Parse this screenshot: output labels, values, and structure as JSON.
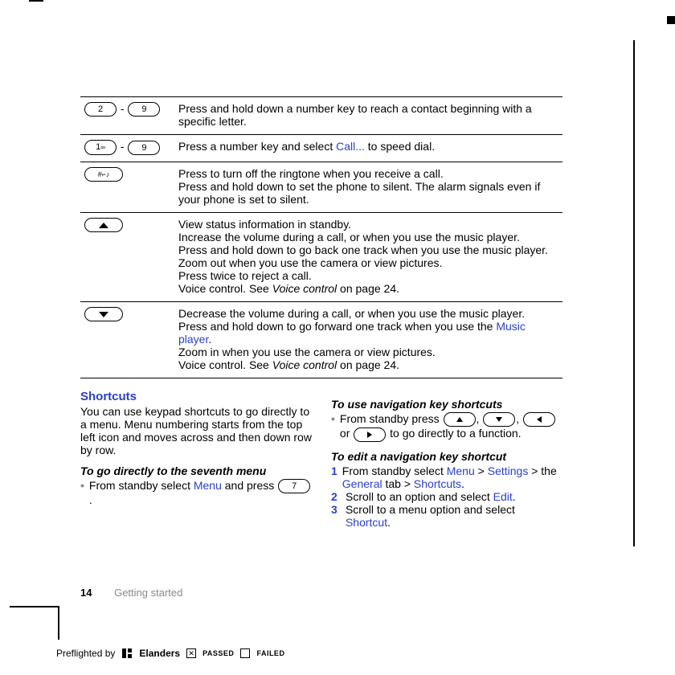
{
  "rows": [
    {
      "keymode": "range",
      "k1": "2",
      "k2": "9",
      "blocks": [
        {
          "text": "Press and hold down a number key to reach a contact beginning with a specific letter."
        }
      ]
    },
    {
      "keymode": "range",
      "k1": "1",
      "k1sub": "∞",
      "k2": "9",
      "blocks": [
        {
          "text": "Press a number key and select "
        },
        {
          "text": "Call...",
          "link": true
        },
        {
          "text": " to speed dial."
        }
      ]
    },
    {
      "keymode": "hash",
      "blocks": [
        {
          "text": "Press to turn off the ringtone when you receive a call."
        },
        {
          "br": true
        },
        {
          "text": "Press and hold down to set the phone to silent. The alarm signals even if your phone is set to silent."
        }
      ]
    },
    {
      "keymode": "up",
      "blocks": [
        {
          "text": "View status information in standby."
        },
        {
          "br": true
        },
        {
          "text": "Increase the volume during a call, or when you use the music player."
        },
        {
          "br": true
        },
        {
          "text": "Press and hold down to go back one track when you use the music player."
        },
        {
          "br": true
        },
        {
          "text": "Zoom out when you use the camera or view pictures."
        },
        {
          "br": true
        },
        {
          "text": "Press twice to reject a call."
        },
        {
          "br": true
        },
        {
          "text": "Voice control. See "
        },
        {
          "text": "Voice control",
          "ital": true
        },
        {
          "text": " on page 24."
        }
      ]
    },
    {
      "keymode": "down",
      "blocks": [
        {
          "text": "Decrease the volume during a call, or when you use the music player."
        },
        {
          "br": true
        },
        {
          "text": "Press and hold down to go forward one track when you use the "
        },
        {
          "text": "Music player",
          "link": true
        },
        {
          "text": "."
        },
        {
          "br": true
        },
        {
          "text": "Zoom in when you use the camera or view pictures."
        },
        {
          "br": true
        },
        {
          "text": "Voice control. See "
        },
        {
          "text": "Voice control",
          "ital": true
        },
        {
          "text": " on page 24."
        }
      ]
    }
  ],
  "shortcuts": {
    "heading": "Shortcuts",
    "intro": "You can use keypad shortcuts to go directly to a menu. Menu numbering starts from the top left icon and moves across and then down row by row.",
    "sevHead": "To go directly to the seventh menu",
    "sevA": "From standby select ",
    "menu": "Menu",
    "sevB": " and press ",
    "sevKey": "7",
    "sevC": " ."
  },
  "nav": {
    "useHead": "To use navigation key shortcuts",
    "useA": "From standby press ",
    "useB": " to go directly to a function.",
    "editHead": "To edit a navigation key shortcut",
    "s1a": "From standby select ",
    "menu": "Menu",
    "gt": " > ",
    "settings": "Settings",
    "s1b": " > the ",
    "general": "General",
    "s1c": " tab > ",
    "shortcutsLink": "Shortcuts",
    "dot": ".",
    "s2a": "Scroll to an option and select ",
    "edit": "Edit",
    "s3a": "Scroll to a menu option and select ",
    "shortcut": "Shortcut",
    "or": " or ",
    "comma": ",  "
  },
  "footer": {
    "page": "14",
    "section": "Getting started"
  },
  "preflight": {
    "by": "Preflighted by",
    "brand": "Elanders",
    "passed": "PASSED",
    "failed": "FAILED"
  }
}
